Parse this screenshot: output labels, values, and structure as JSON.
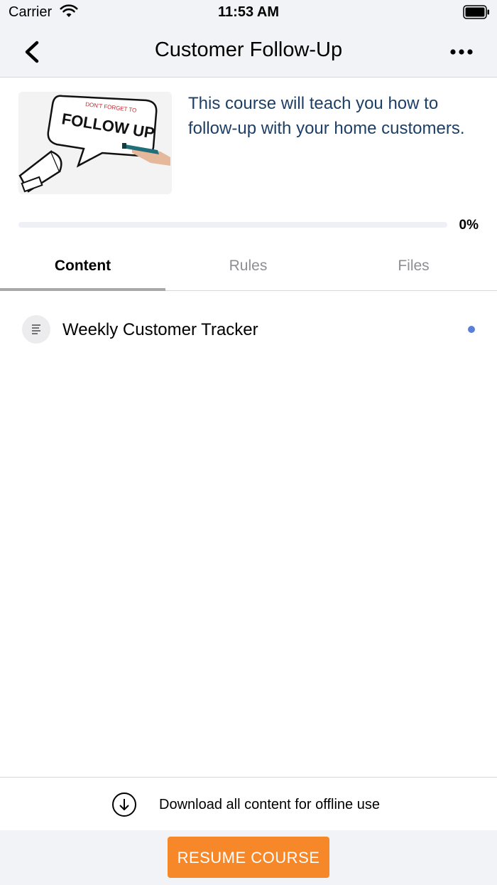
{
  "status_bar": {
    "carrier": "Carrier",
    "time": "11:53 AM"
  },
  "nav": {
    "title": "Customer Follow-Up",
    "back_icon": "chevron-left-icon",
    "more_icon": "ellipsis-icon"
  },
  "course": {
    "image_alt": "Don't forget to follow up illustration",
    "image_text_small": "DON'T FORGET TO",
    "image_text_large": "FOLLOW UP",
    "description": "This course will teach you how to follow-up with your home customers.",
    "progress": 0,
    "progress_label": "0%"
  },
  "tabs": [
    {
      "label": "Content",
      "active": true
    },
    {
      "label": "Rules",
      "active": false
    },
    {
      "label": "Files",
      "active": false
    }
  ],
  "content_items": [
    {
      "label": "Weekly Customer Tracker",
      "icon": "document-lines-icon",
      "unread": true
    }
  ],
  "download": {
    "label": "Download all content for offline use",
    "icon": "download-circle-icon"
  },
  "footer": {
    "resume_label": "RESUME COURSE"
  },
  "colors": {
    "accent": "#f6882a",
    "description_text": "#1d3f66",
    "unread_dot": "#5a7fd6",
    "bar_bg": "#f2f3f7"
  }
}
